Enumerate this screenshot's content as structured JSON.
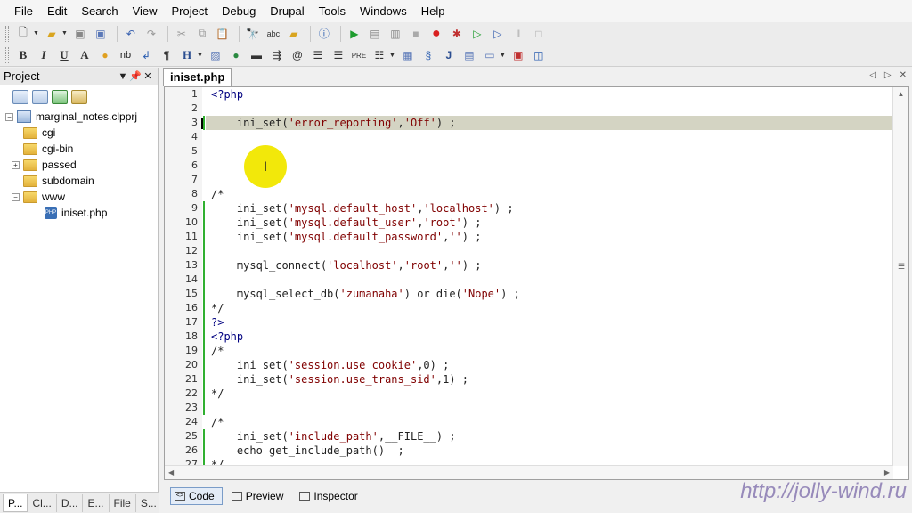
{
  "menu": [
    "File",
    "Edit",
    "Search",
    "View",
    "Project",
    "Debug",
    "Drupal",
    "Tools",
    "Windows",
    "Help"
  ],
  "toolbar1": {
    "icons": [
      "new-file-icon",
      "open-folder-icon",
      "save-icon",
      "save-all-icon",
      "undo-icon",
      "redo-icon",
      "cut-icon",
      "copy-icon",
      "paste-icon",
      "find-icon",
      "replace-icon",
      "find-in-files-icon",
      "help-icon",
      "run-icon",
      "run-config-icon",
      "step-icon",
      "stop-icon",
      "record-icon",
      "debug-breakpoint-icon",
      "debug-run-icon",
      "debug-step-icon",
      "pause-icon",
      "stop-debug-icon"
    ]
  },
  "toolbar2": {
    "bold": "B",
    "italic": "I",
    "underline": "U",
    "font": "A",
    "nbsp": "nb",
    "paragraph": "¶",
    "heading": "H",
    "pre": "PRE",
    "js": "J"
  },
  "project": {
    "title": "Project",
    "tree": [
      {
        "label": "marginal_notes.clpprj",
        "type": "project",
        "level": 0
      },
      {
        "label": "cgi",
        "type": "folder",
        "level": 1
      },
      {
        "label": "cgi-bin",
        "type": "folder",
        "level": 1
      },
      {
        "label": "passed",
        "type": "folder",
        "level": 1
      },
      {
        "label": "subdomain",
        "type": "folder",
        "level": 1
      },
      {
        "label": "www",
        "type": "folder",
        "level": 1
      },
      {
        "label": "iniset.php",
        "type": "php",
        "level": 2
      }
    ],
    "bottom_tabs": [
      "P...",
      "Cl...",
      "D...",
      "E...",
      "File",
      "S..."
    ]
  },
  "editor": {
    "tab": "iniset.php",
    "lines": [
      "<?php",
      "",
      "    ini_set('error_reporting','Off') ;",
      "",
      "",
      "",
      "",
      "/*",
      "    ini_set('mysql.default_host','localhost') ;",
      "    ini_set('mysql.default_user','root') ;",
      "    ini_set('mysql.default_password','') ;",
      "",
      "    mysql_connect('localhost','root','') ;",
      "",
      "    mysql_select_db('zumanaha') or die('Nope') ;",
      "*/",
      "?>",
      "<?php",
      "/*",
      "    ini_set('session.use_cookie',0) ;",
      "    ini_set('session.use_trans_sid',1) ;",
      "*/",
      "",
      "/*",
      "    ini_set('include_path',__FILE__) ;",
      "    echo get_include_path()  ;",
      "*/"
    ],
    "line_numbers": [
      "1",
      "2",
      "3",
      "4",
      "5",
      "6",
      "7",
      "8",
      "9",
      "10",
      "11",
      "12",
      "13",
      "14",
      "15",
      "16",
      "17",
      "18",
      "19",
      "20",
      "21",
      "22",
      "23",
      "24",
      "25",
      "26",
      "27"
    ],
    "current_line": 3,
    "bottom_tabs": [
      "Code",
      "Preview",
      "Inspector"
    ]
  },
  "watermark": "http://jolly-wind.ru"
}
